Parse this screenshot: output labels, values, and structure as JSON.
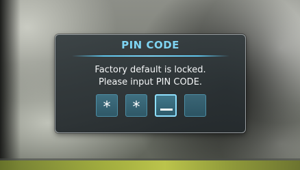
{
  "dialog": {
    "title": "PIN CODE",
    "message_line1": "Factory default is locked.",
    "message_line2": "Please input PIN CODE.",
    "pin_digits": [
      {
        "value": "*",
        "state": "filled"
      },
      {
        "value": "*",
        "state": "filled"
      },
      {
        "value": "",
        "state": "active"
      },
      {
        "value": "",
        "state": "empty"
      }
    ]
  },
  "colors": {
    "title": "#7fd4f2",
    "divider": "#5fc6ee",
    "panel": "#343c3f",
    "pin_box": "#3f6f80",
    "active_border": "#8fe0ff",
    "text": "#ffffff"
  }
}
